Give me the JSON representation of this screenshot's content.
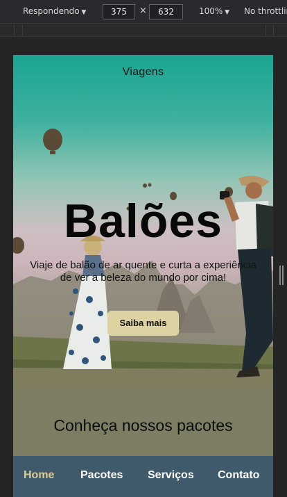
{
  "devtools": {
    "mode": "Respondendo",
    "width": "375",
    "times": "×",
    "height": "632",
    "zoom": "100%",
    "throttling": "No throttling"
  },
  "site": {
    "brand": "Viagens",
    "hero_title": "Balões",
    "hero_text": "Viaje de balão de ar quente e curta a experiência de ver a beleza do mundo por cima!",
    "cta_label": "Saiba mais",
    "packages_title": "Conheça nossos pacotes"
  },
  "nav": {
    "items": [
      {
        "label": "Home",
        "active": true
      },
      {
        "label": "Pacotes",
        "active": false
      },
      {
        "label": "Serviços",
        "active": false
      },
      {
        "label": "Contato",
        "active": false
      }
    ]
  },
  "colors": {
    "nav_background": "#3e5a6b",
    "nav_active": "#dccd94",
    "cta_background": "#ddd3a2",
    "section_background": "#7d7d63"
  }
}
